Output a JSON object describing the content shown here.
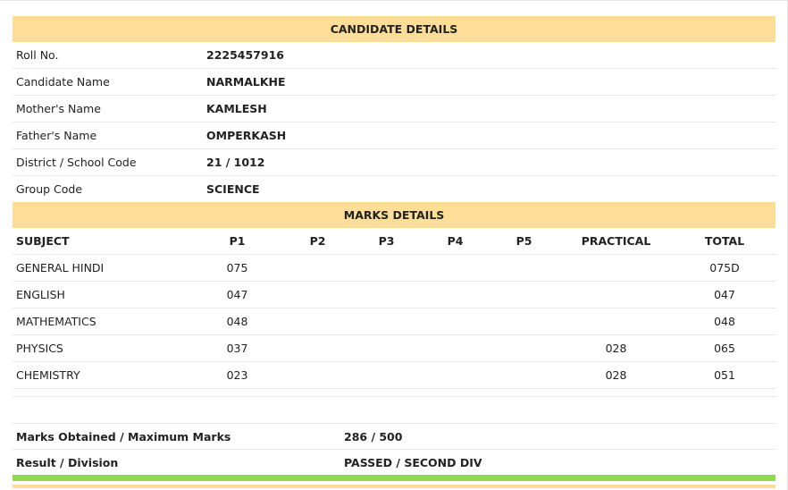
{
  "candidate_section": {
    "title": "CANDIDATE DETAILS",
    "rows": [
      {
        "label": "Roll No.",
        "value": "2225457916"
      },
      {
        "label": "Candidate Name",
        "value": "NARMALKHE"
      },
      {
        "label": "Mother's Name",
        "value": "KAMLESH"
      },
      {
        "label": "Father's Name",
        "value": "OMPERKASH"
      },
      {
        "label": "District / School Code",
        "value": "21 / 1012"
      },
      {
        "label": "Group Code",
        "value": "SCIENCE"
      }
    ]
  },
  "marks_section": {
    "title": "MARKS DETAILS",
    "headers": {
      "subject": "SUBJECT",
      "p1": "P1",
      "p2": "P2",
      "p3": "P3",
      "p4": "P4",
      "p5": "P5",
      "practical": "PRACTICAL",
      "total": "TOTAL"
    },
    "rows": [
      {
        "subject": "GENERAL HINDI",
        "p1": "075",
        "p2": "",
        "p3": "",
        "p4": "",
        "p5": "",
        "practical": "",
        "total": "075D"
      },
      {
        "subject": "ENGLISH",
        "p1": "047",
        "p2": "",
        "p3": "",
        "p4": "",
        "p5": "",
        "practical": "",
        "total": "047"
      },
      {
        "subject": "MATHEMATICS",
        "p1": "048",
        "p2": "",
        "p3": "",
        "p4": "",
        "p5": "",
        "practical": "",
        "total": "048"
      },
      {
        "subject": "PHYSICS",
        "p1": "037",
        "p2": "",
        "p3": "",
        "p4": "",
        "p5": "",
        "practical": "028",
        "total": "065"
      },
      {
        "subject": "CHEMISTRY",
        "p1": "023",
        "p2": "",
        "p3": "",
        "p4": "",
        "p5": "",
        "practical": "028",
        "total": "051"
      }
    ]
  },
  "summary": {
    "marks_label": "Marks Obtained / Maximum Marks",
    "marks_value": "286 / 500",
    "result_label": "Result / Division",
    "result_value": "PASSED / SECOND DIV"
  },
  "colors": {
    "section_header_bg": "#fedd98",
    "result_bar": "#92d952"
  }
}
